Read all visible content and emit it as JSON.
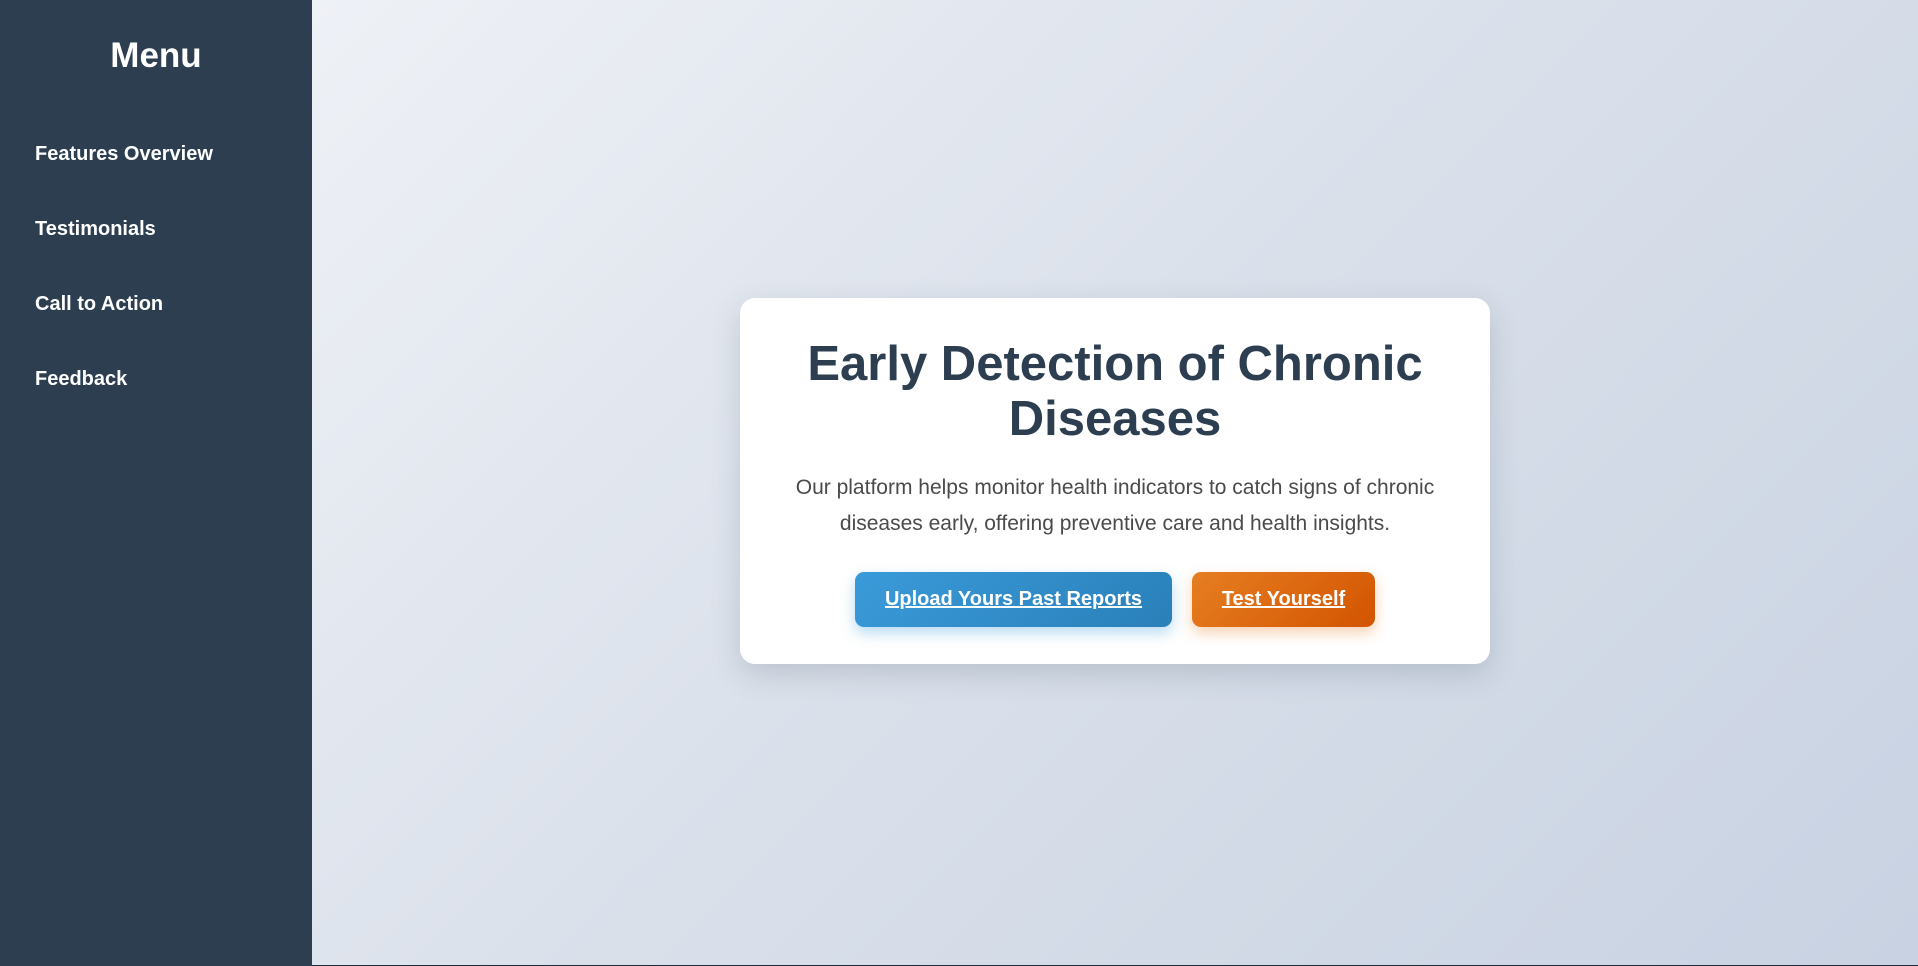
{
  "sidebar": {
    "title": "Menu",
    "items": [
      {
        "label": "Features Overview"
      },
      {
        "label": "Testimonials"
      },
      {
        "label": "Call to Action"
      },
      {
        "label": "Feedback"
      }
    ]
  },
  "hero": {
    "title": "Early Detection of Chronic Diseases",
    "description": "Our platform helps monitor health indicators to catch signs of chronic diseases early, offering preventive care and health insights.",
    "buttons": {
      "upload_label": "Upload Yours Past Reports",
      "test_label": "Test Yourself"
    }
  },
  "colors": {
    "sidebar_bg": "#2c3e50",
    "title_text": "#2c3e50",
    "upload_button": "#3498db",
    "test_button": "#e67e22"
  }
}
